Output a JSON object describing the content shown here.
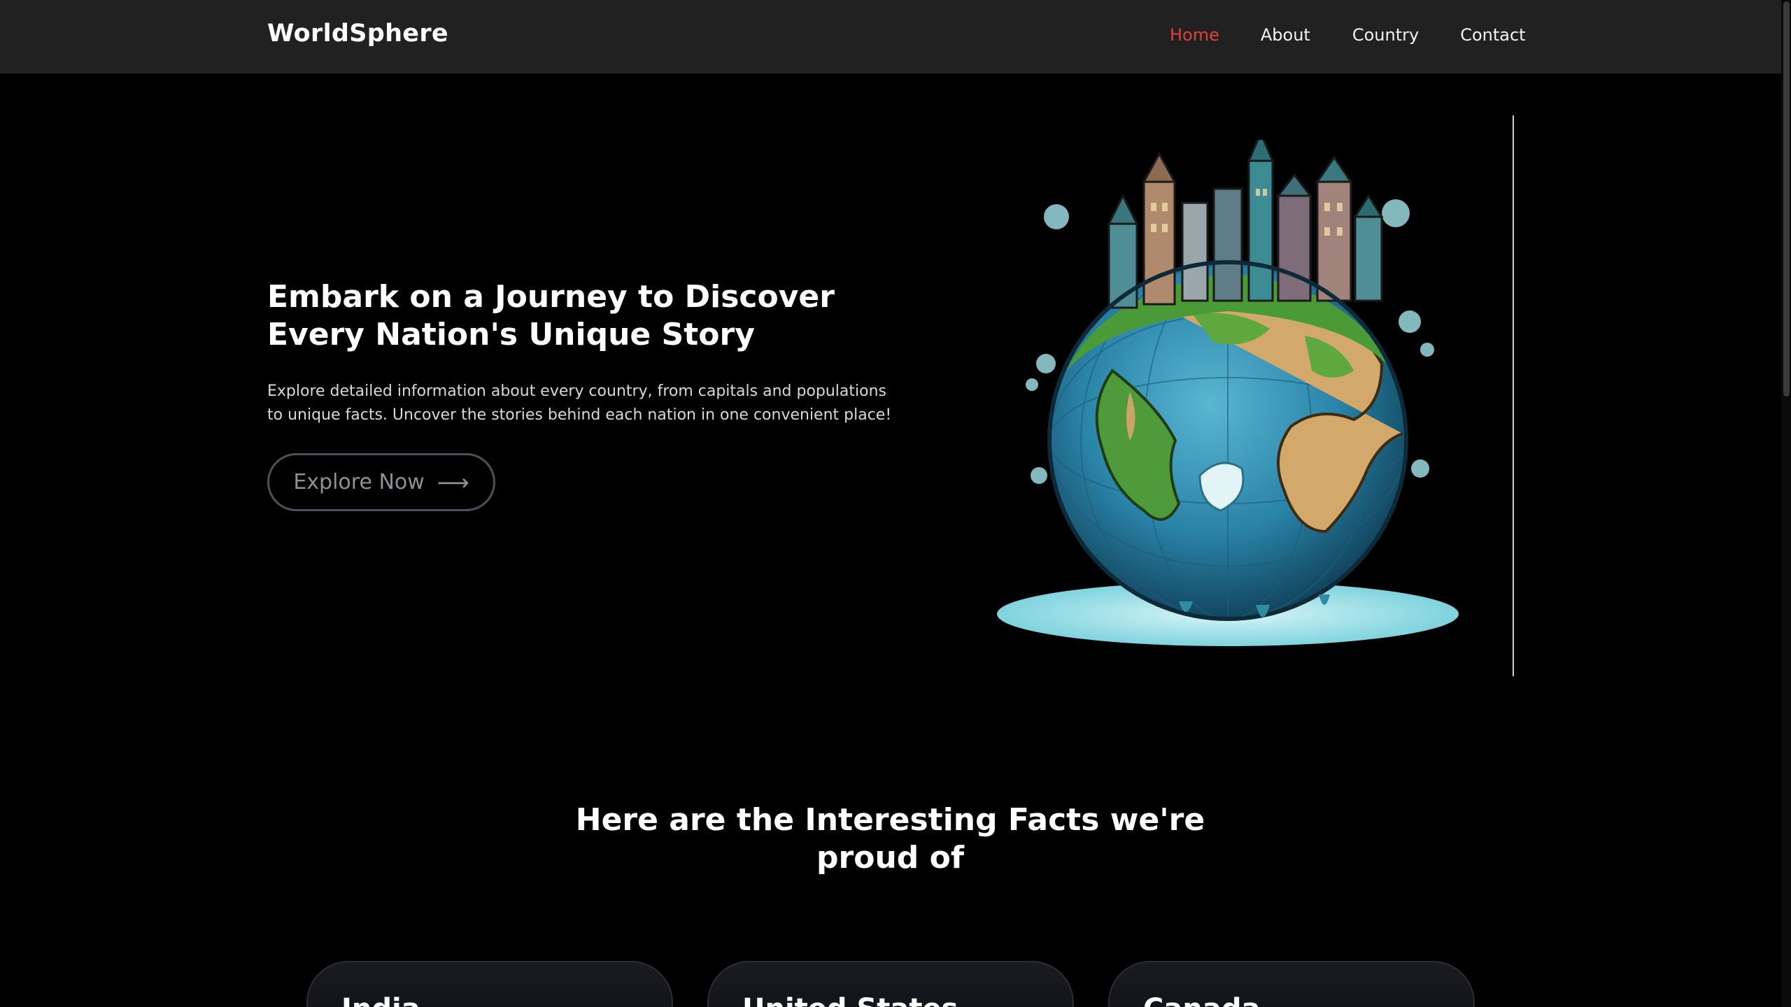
{
  "header": {
    "logo": "WorldSphere",
    "nav": [
      {
        "label": "Home",
        "active": true
      },
      {
        "label": "About",
        "active": false
      },
      {
        "label": "Country",
        "active": false
      },
      {
        "label": "Contact",
        "active": false
      }
    ]
  },
  "hero": {
    "title": "Embark on a Journey to Discover Every Nation's Unique Story",
    "description": "Explore detailed information about every country, from capitals and populations to unique facts. Uncover the stories behind each nation in one convenient place!",
    "button_label": "Explore Now",
    "button_icon": "arrow-right-icon",
    "image": "globe-with-city-illustration"
  },
  "facts": {
    "title": "Here are the Interesting Facts we're proud of",
    "cards": [
      {
        "title": "India"
      },
      {
        "title": "United States"
      },
      {
        "title": "Canada"
      }
    ]
  },
  "colors": {
    "header_bg": "#212121",
    "page_bg": "#000000",
    "accent": "#e0403a",
    "button_border": "#4b5158"
  }
}
